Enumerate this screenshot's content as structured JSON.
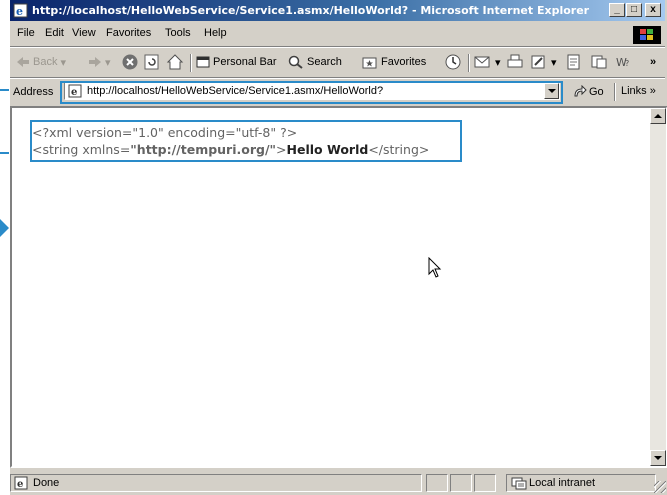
{
  "window": {
    "title": "http://localhost/HelloWebService/Service1.asmx/HelloWorld? - Microsoft Internet Explorer",
    "minimize": "_",
    "maximize": "□",
    "close": "x"
  },
  "menu": {
    "items": [
      "File",
      "Edit",
      "View",
      "Favorites",
      "Tools",
      "Help"
    ]
  },
  "toolbar": {
    "back": "Back",
    "personal_bar": "Personal Bar",
    "search": "Search",
    "favorites": "Favorites",
    "overflow": "»"
  },
  "address": {
    "label": "Address",
    "url": "http://localhost/HelloWebService/Service1.asmx/HelloWorld?",
    "go": "Go",
    "links": "Links »"
  },
  "document": {
    "decl_text": "<?xml version=\"1.0\" encoding=\"utf-8\" ?>",
    "open_tag": "<string",
    "attr_name": " xmlns=",
    "attr_value": "\"http://tempuri.org/\"",
    "tag_close": ">",
    "value": "Hello World",
    "end_tag": "</string>"
  },
  "status": {
    "text": "Done",
    "zone": "Local intranet"
  },
  "colors": {
    "highlight": "#2a8bc9",
    "titlebar_start": "#0a246a",
    "titlebar_end": "#a6caf0"
  }
}
